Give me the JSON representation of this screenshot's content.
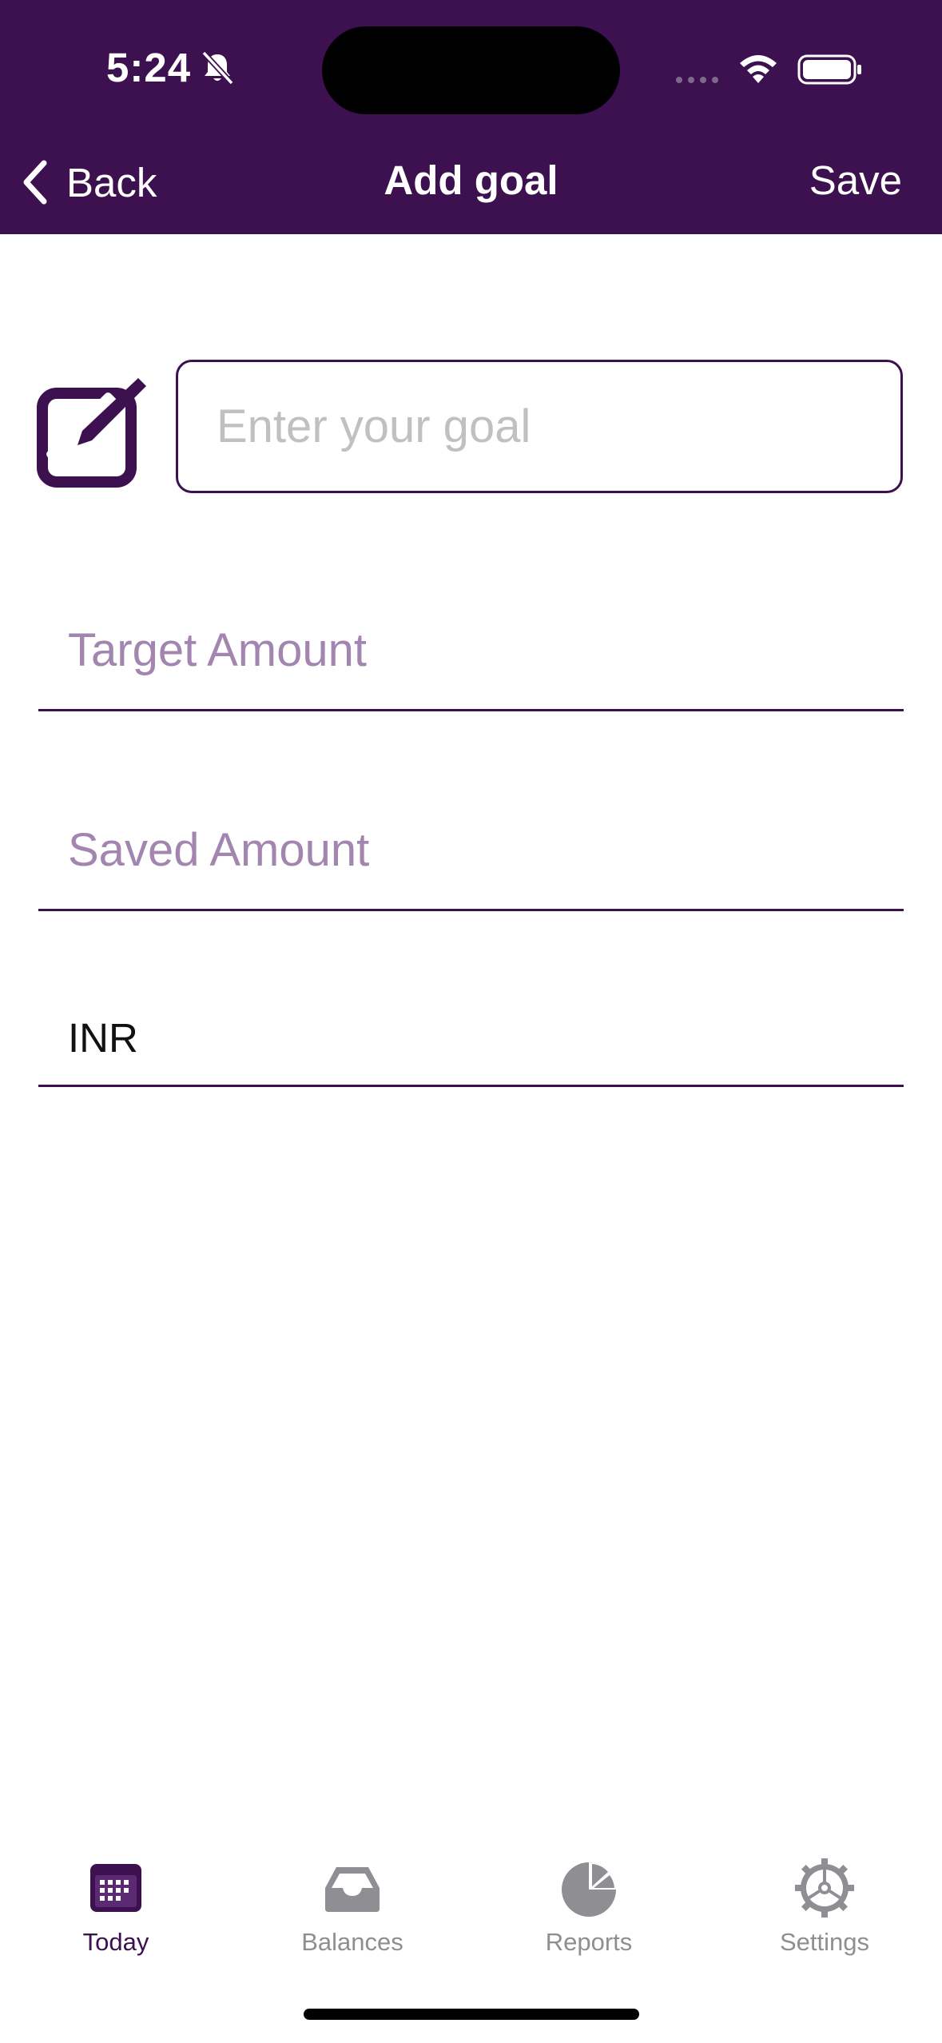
{
  "status_bar": {
    "time": "5:24",
    "icons": [
      "bell-off-icon",
      "signal-dots-icon",
      "wifi-icon",
      "battery-icon"
    ]
  },
  "nav": {
    "back_label": "Back",
    "title": "Add goal",
    "save_label": "Save"
  },
  "form": {
    "goal_placeholder": "Enter your goal",
    "goal_value": "",
    "target_placeholder": "Target Amount",
    "target_value": "",
    "saved_placeholder": "Saved Amount",
    "saved_value": "",
    "currency": "INR"
  },
  "tabs": [
    {
      "label": "Today",
      "icon": "calendar-icon",
      "active": true
    },
    {
      "label": "Balances",
      "icon": "inbox-icon",
      "active": false
    },
    {
      "label": "Reports",
      "icon": "pie-chart-icon",
      "active": false
    },
    {
      "label": "Settings",
      "icon": "gear-icon",
      "active": false
    }
  ],
  "colors": {
    "primary": "#3d1150",
    "placeholder_accent": "#a386b0",
    "inactive_tab": "#8e8e93"
  }
}
